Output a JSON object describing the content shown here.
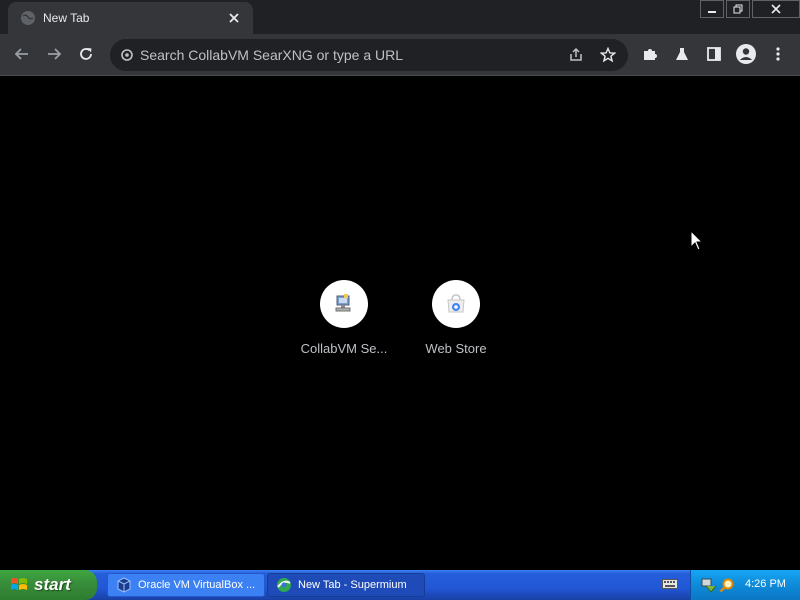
{
  "browser": {
    "tab": {
      "title": "New Tab"
    },
    "omnibox": {
      "placeholder": "Search CollabVM SearXNG or type a URL"
    }
  },
  "ntp": {
    "shortcuts": [
      {
        "label": "CollabVM Se..."
      },
      {
        "label": "Web Store"
      }
    ]
  },
  "taskbar": {
    "start_label": "start",
    "tasks": [
      {
        "label": "Oracle VM VirtualBox ...",
        "active": false
      },
      {
        "label": "New Tab - Supermium",
        "active": true
      }
    ],
    "clock": "4:26 PM"
  },
  "colors": {
    "tabstrip": "#202124",
    "toolbar": "#35363a",
    "page_background": "#000000",
    "taskbar": "#245edb",
    "start_button": "#388e3c"
  }
}
